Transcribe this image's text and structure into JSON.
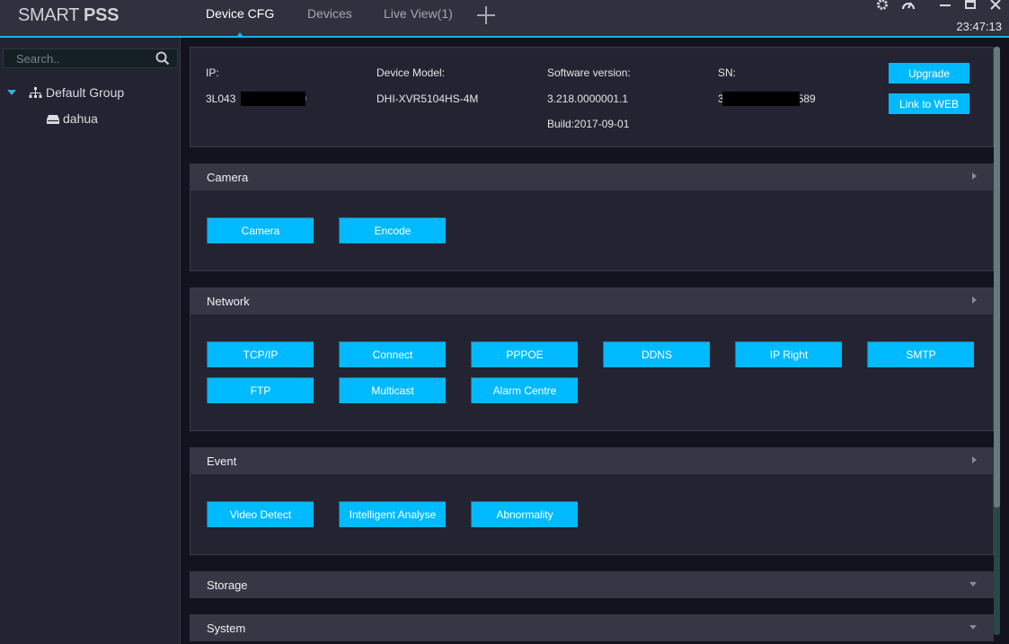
{
  "app": {
    "logo_light": "SMART ",
    "logo_bold": "PSS",
    "clock": "23:47:13"
  },
  "tabs": [
    {
      "label": "Device CFG",
      "active": true
    },
    {
      "label": "Devices",
      "active": false
    },
    {
      "label": "Live View(1)",
      "active": false
    }
  ],
  "window_icons": [
    "gear-icon",
    "speedometer-icon",
    "minimize-icon",
    "maximize-icon",
    "close-icon"
  ],
  "sidebar": {
    "search_placeholder": "Search..",
    "group": "Default Group",
    "device": "dahua"
  },
  "device_info": {
    "ip_label": "IP:",
    "ip_value_prefix": "3L043",
    "ip_value_suffix": "9",
    "model_label": "Device Model:",
    "model_value": "DHI-XVR5104HS-4M",
    "sw_label": "Software version:",
    "sw_value": "3.218.0000001.1",
    "build": "Build:2017-09-01",
    "sn_label": "SN:",
    "sn_value_prefix": "3",
    "sn_value_suffix": "589",
    "upgrade_label": "Upgrade",
    "link_web_label": "Link to WEB"
  },
  "sections": {
    "camera": {
      "title": "Camera",
      "expanded": true,
      "buttons": [
        "Camera",
        "Encode"
      ]
    },
    "network": {
      "title": "Network",
      "expanded": true,
      "buttons": [
        "TCP/IP",
        "Connect",
        "PPPOE",
        "DDNS",
        "IP Right",
        "SMTP",
        "FTP",
        "Multicast",
        "Alarm Centre"
      ]
    },
    "event": {
      "title": "Event",
      "expanded": true,
      "buttons": [
        "Video Detect",
        "Intelligent Analyse",
        "Abnormality"
      ]
    },
    "storage": {
      "title": "Storage",
      "expanded": false
    },
    "system": {
      "title": "System",
      "expanded": false
    }
  },
  "colors": {
    "accent": "#12b4ea",
    "button": "#00baff",
    "panel": "#232332",
    "header": "#363645",
    "background": "#13131f"
  }
}
